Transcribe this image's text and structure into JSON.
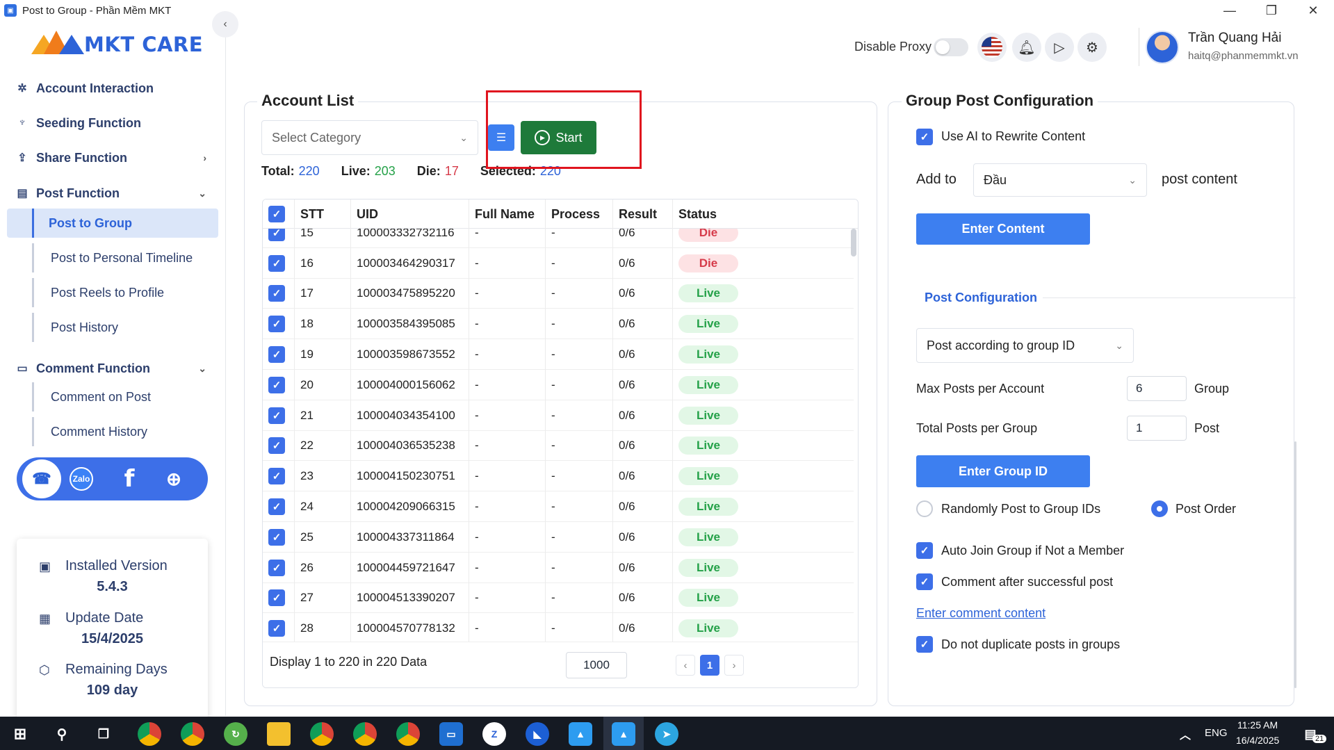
{
  "window": {
    "title": "Post to Group - Phần Mềm MKT",
    "minimize": "—",
    "maximize": "❐",
    "close": "✕"
  },
  "brand": {
    "name": "MKT CARE",
    "accent": "#2d63d8"
  },
  "sidebar": {
    "collapse_icon": "‹",
    "items": [
      {
        "label": "Account Interaction",
        "icon": "sparkle-icon"
      },
      {
        "label": "Seeding Function",
        "icon": "sprout-icon"
      },
      {
        "label": "Share Function",
        "icon": "share-icon",
        "chevron": "›"
      },
      {
        "label": "Post Function",
        "icon": "post-icon",
        "chevron": "⌄"
      },
      {
        "label": "Comment Function",
        "icon": "comment-icon",
        "chevron": "⌄"
      }
    ],
    "post_sub": [
      "Post to Group",
      "Post to Personal Timeline",
      "Post Reels to Profile",
      "Post History"
    ],
    "comment_sub": [
      "Comment on Post",
      "Comment History"
    ],
    "social": {
      "zalo": "Zalo"
    },
    "version": {
      "installed_label": "Installed Version",
      "installed_value": "5.4.3",
      "update_label": "Update Date",
      "update_value": "15/4/2025",
      "remaining_label": "Remaining Days",
      "remaining_value": "109 day"
    }
  },
  "header": {
    "proxy_label": "Disable Proxy",
    "proxy_enabled": false,
    "user_name": "Trần Quang Hải",
    "user_email": "haitq@phanmemmkt.vn"
  },
  "account_list": {
    "title": "Account List",
    "category_placeholder": "Select Category",
    "start_label": "Start",
    "stats": {
      "total_label": "Total:",
      "total": "220",
      "live_label": "Live:",
      "live": "203",
      "die_label": "Die:",
      "die": "17",
      "selected_label": "Selected:",
      "selected": "220"
    },
    "stat_colors": {
      "total": "#2d63d8",
      "live": "#24a148",
      "die": "#d63b4a",
      "selected": "#2d63d8"
    },
    "columns": [
      "STT",
      "UID",
      "Full Name",
      "Process",
      "Result",
      "Status"
    ],
    "rows": [
      {
        "stt": "15",
        "uid": "100003332732116",
        "name": "-",
        "process": "-",
        "result": "0/6",
        "status": "Die"
      },
      {
        "stt": "16",
        "uid": "100003464290317",
        "name": "-",
        "process": "-",
        "result": "0/6",
        "status": "Die"
      },
      {
        "stt": "17",
        "uid": "100003475895220",
        "name": "-",
        "process": "-",
        "result": "0/6",
        "status": "Live"
      },
      {
        "stt": "18",
        "uid": "100003584395085",
        "name": "-",
        "process": "-",
        "result": "0/6",
        "status": "Live"
      },
      {
        "stt": "19",
        "uid": "100003598673552",
        "name": "-",
        "process": "-",
        "result": "0/6",
        "status": "Live"
      },
      {
        "stt": "20",
        "uid": "100004000156062",
        "name": "-",
        "process": "-",
        "result": "0/6",
        "status": "Live"
      },
      {
        "stt": "21",
        "uid": "100004034354100",
        "name": "-",
        "process": "-",
        "result": "0/6",
        "status": "Live"
      },
      {
        "stt": "22",
        "uid": "100004036535238",
        "name": "-",
        "process": "-",
        "result": "0/6",
        "status": "Live"
      },
      {
        "stt": "23",
        "uid": "100004150230751",
        "name": "-",
        "process": "-",
        "result": "0/6",
        "status": "Live"
      },
      {
        "stt": "24",
        "uid": "100004209066315",
        "name": "-",
        "process": "-",
        "result": "0/6",
        "status": "Live"
      },
      {
        "stt": "25",
        "uid": "100004337311864",
        "name": "-",
        "process": "-",
        "result": "0/6",
        "status": "Live"
      },
      {
        "stt": "26",
        "uid": "100004459721647",
        "name": "-",
        "process": "-",
        "result": "0/6",
        "status": "Live"
      },
      {
        "stt": "27",
        "uid": "100004513390207",
        "name": "-",
        "process": "-",
        "result": "0/6",
        "status": "Live"
      },
      {
        "stt": "28",
        "uid": "100004570778132",
        "name": "-",
        "process": "-",
        "result": "0/6",
        "status": "Live"
      }
    ],
    "footer": {
      "display_text": "Display 1 to 220 in 220 Data",
      "page_size": "1000",
      "current_page": "1",
      "prev": "‹",
      "next": "›"
    }
  },
  "group_post": {
    "title": "Group Post Configuration",
    "use_ai_label": "Use AI to Rewrite Content",
    "use_ai_checked": true,
    "add_to_label": "Add to",
    "add_to_value": "Đầu",
    "post_content_label": "post content",
    "enter_content_button": "Enter Content",
    "post_config_label": "Post Configuration",
    "post_mode_value": "Post according to group ID",
    "max_posts_label": "Max Posts per Account",
    "max_posts_value": "6",
    "max_posts_unit": "Group",
    "total_posts_label": "Total Posts per Group",
    "total_posts_value": "1",
    "total_posts_unit": "Post",
    "enter_group_button": "Enter Group ID",
    "random_label": "Randomly Post to Group IDs",
    "order_label": "Post Order",
    "selected_order": "Post Order",
    "auto_join_label": "Auto Join Group if Not a Member",
    "auto_join_checked": true,
    "comment_after_label": "Comment after successful post",
    "comment_after_checked": true,
    "enter_comment_link": "Enter comment content",
    "no_duplicate_label": "Do not duplicate posts in groups",
    "no_duplicate_checked": true
  },
  "taskbar": {
    "language": "ENG",
    "time": "11:25 AM",
    "date": "16/4/2025",
    "notification_count": "21"
  }
}
